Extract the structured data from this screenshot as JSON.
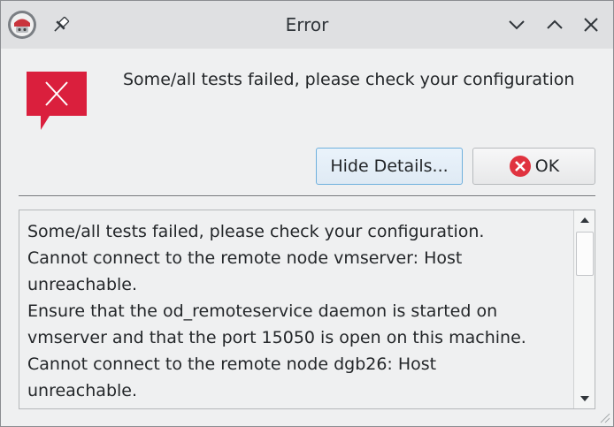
{
  "window": {
    "title": "Error"
  },
  "dialog": {
    "message": "Some/all tests failed, please check your configuration",
    "buttons": {
      "details_label": "Hide Details...",
      "ok_label": "OK"
    },
    "details": {
      "lines": [
        "Some/all tests failed, please check your configuration.",
        "Cannot connect to the remote node vmserver: Host",
        "unreachable.",
        "Ensure that the od_remoteservice daemon is started on",
        "vmserver and that the port 15050 is open on this machine.",
        "Cannot connect to the remote node dgb26: Host",
        "unreachable."
      ]
    }
  },
  "icons": {
    "app": "app-icon",
    "pin": "pin-icon",
    "minimize": "chevron-down-icon",
    "maximize": "chevron-up-icon",
    "close": "close-icon",
    "error": "error-icon",
    "ok": "cancel-circle-icon",
    "scroll_up": "arrow-up-icon",
    "scroll_down": "arrow-down-icon"
  },
  "colors": {
    "error_red": "#da1f3d",
    "ok_icon_red": "#e0333f",
    "accent_border": "#6fb0dd"
  }
}
